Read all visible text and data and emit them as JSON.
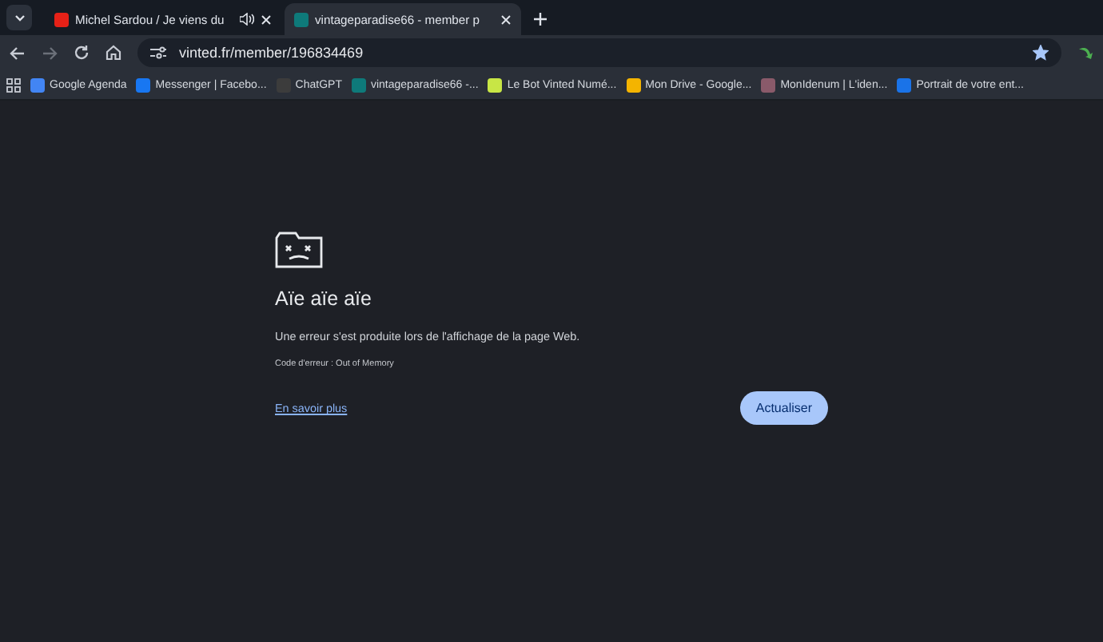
{
  "tabs": [
    {
      "title": "Michel Sardou / Je viens du",
      "selected": false,
      "audio": true,
      "color": "#e62117"
    },
    {
      "title": "vintageparadise66 - member p",
      "selected": true,
      "audio": false,
      "color": "#0e7a7a"
    }
  ],
  "address_bar": {
    "url": "vinted.fr/member/196834469",
    "bookmarked": true
  },
  "bookmarks": [
    {
      "label": "Google Agenda",
      "color": "#4285f4"
    },
    {
      "label": "Messenger | Facebo...",
      "color": "#1877f2"
    },
    {
      "label": "ChatGPT",
      "color": "#3c3c3c"
    },
    {
      "label": "vintageparadise66 -...",
      "color": "#0e7a7a"
    },
    {
      "label": "Le Bot Vinted Numé...",
      "color": "#c8e645"
    },
    {
      "label": "Mon Drive - Google...",
      "color": "#f4b400"
    },
    {
      "label": "MonIdenum | L'iden...",
      "color": "#8a5a6a"
    },
    {
      "label": "Portrait de votre ent...",
      "color": "#1a73e8"
    }
  ],
  "error": {
    "title": "Aïe aïe aïe",
    "message": "Une erreur s'est produite lors de l'affichage de la page Web.",
    "code": "Code d'erreur : Out of Memory",
    "link": "En savoir plus",
    "button": "Actualiser"
  }
}
